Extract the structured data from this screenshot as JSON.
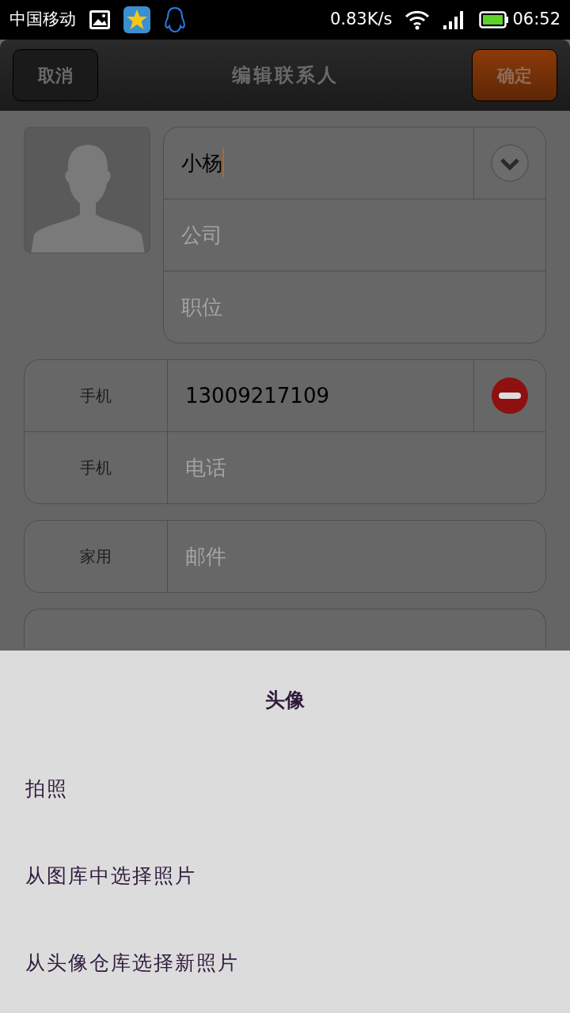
{
  "status_bar": {
    "carrier": "中国移动",
    "speed": "0.83K/s",
    "time": "06:52"
  },
  "header": {
    "cancel": "取消",
    "title": "编辑联系人",
    "confirm": "确定"
  },
  "name_card": {
    "name": "小杨",
    "company_placeholder": "公司",
    "position_placeholder": "职位"
  },
  "phones": [
    {
      "label": "手机",
      "value": "13009217109",
      "removable": true
    },
    {
      "label": "手机",
      "placeholder": "电话",
      "removable": false
    }
  ],
  "email": {
    "label": "家用",
    "placeholder": "邮件"
  },
  "sheet": {
    "title": "头像",
    "options": [
      "拍照",
      "从图库中选择照片",
      "从头像仓库选择新照片"
    ]
  }
}
